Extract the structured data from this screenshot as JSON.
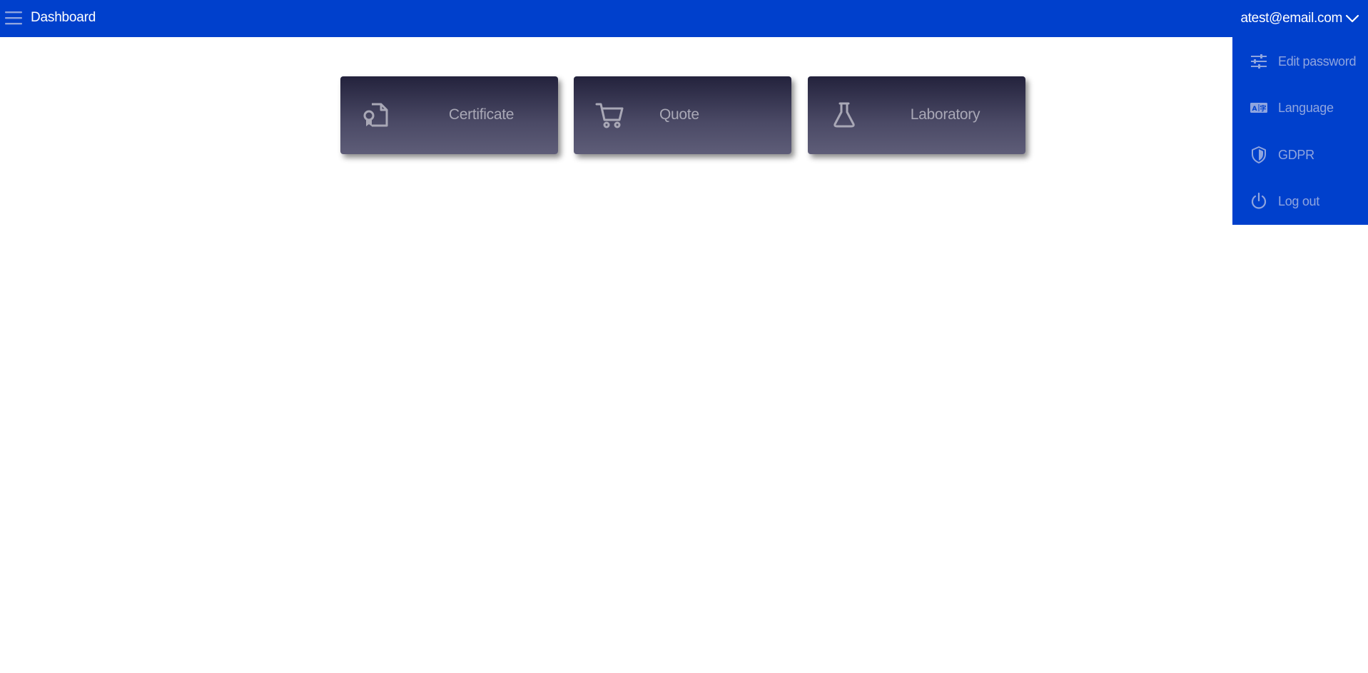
{
  "header": {
    "title": "Dashboard",
    "menu_icon": "hamburger-menu-icon",
    "user_email": "atest@email.com",
    "chevron_icon": "chevron-down-icon",
    "background_color": "#0040cc"
  },
  "cards": [
    {
      "label": "Certificate",
      "icon": "certificate-file-icon"
    },
    {
      "label": "Quote",
      "icon": "shopping-cart-icon"
    },
    {
      "label": "Laboratory",
      "icon": "flask-icon"
    }
  ],
  "user_menu": {
    "items": [
      {
        "label": "Edit password",
        "icon": "sliders-icon"
      },
      {
        "label": "Language",
        "icon": "language-icon"
      },
      {
        "label": "GDPR",
        "icon": "shield-icon"
      },
      {
        "label": "Log out",
        "icon": "power-icon"
      }
    ]
  }
}
